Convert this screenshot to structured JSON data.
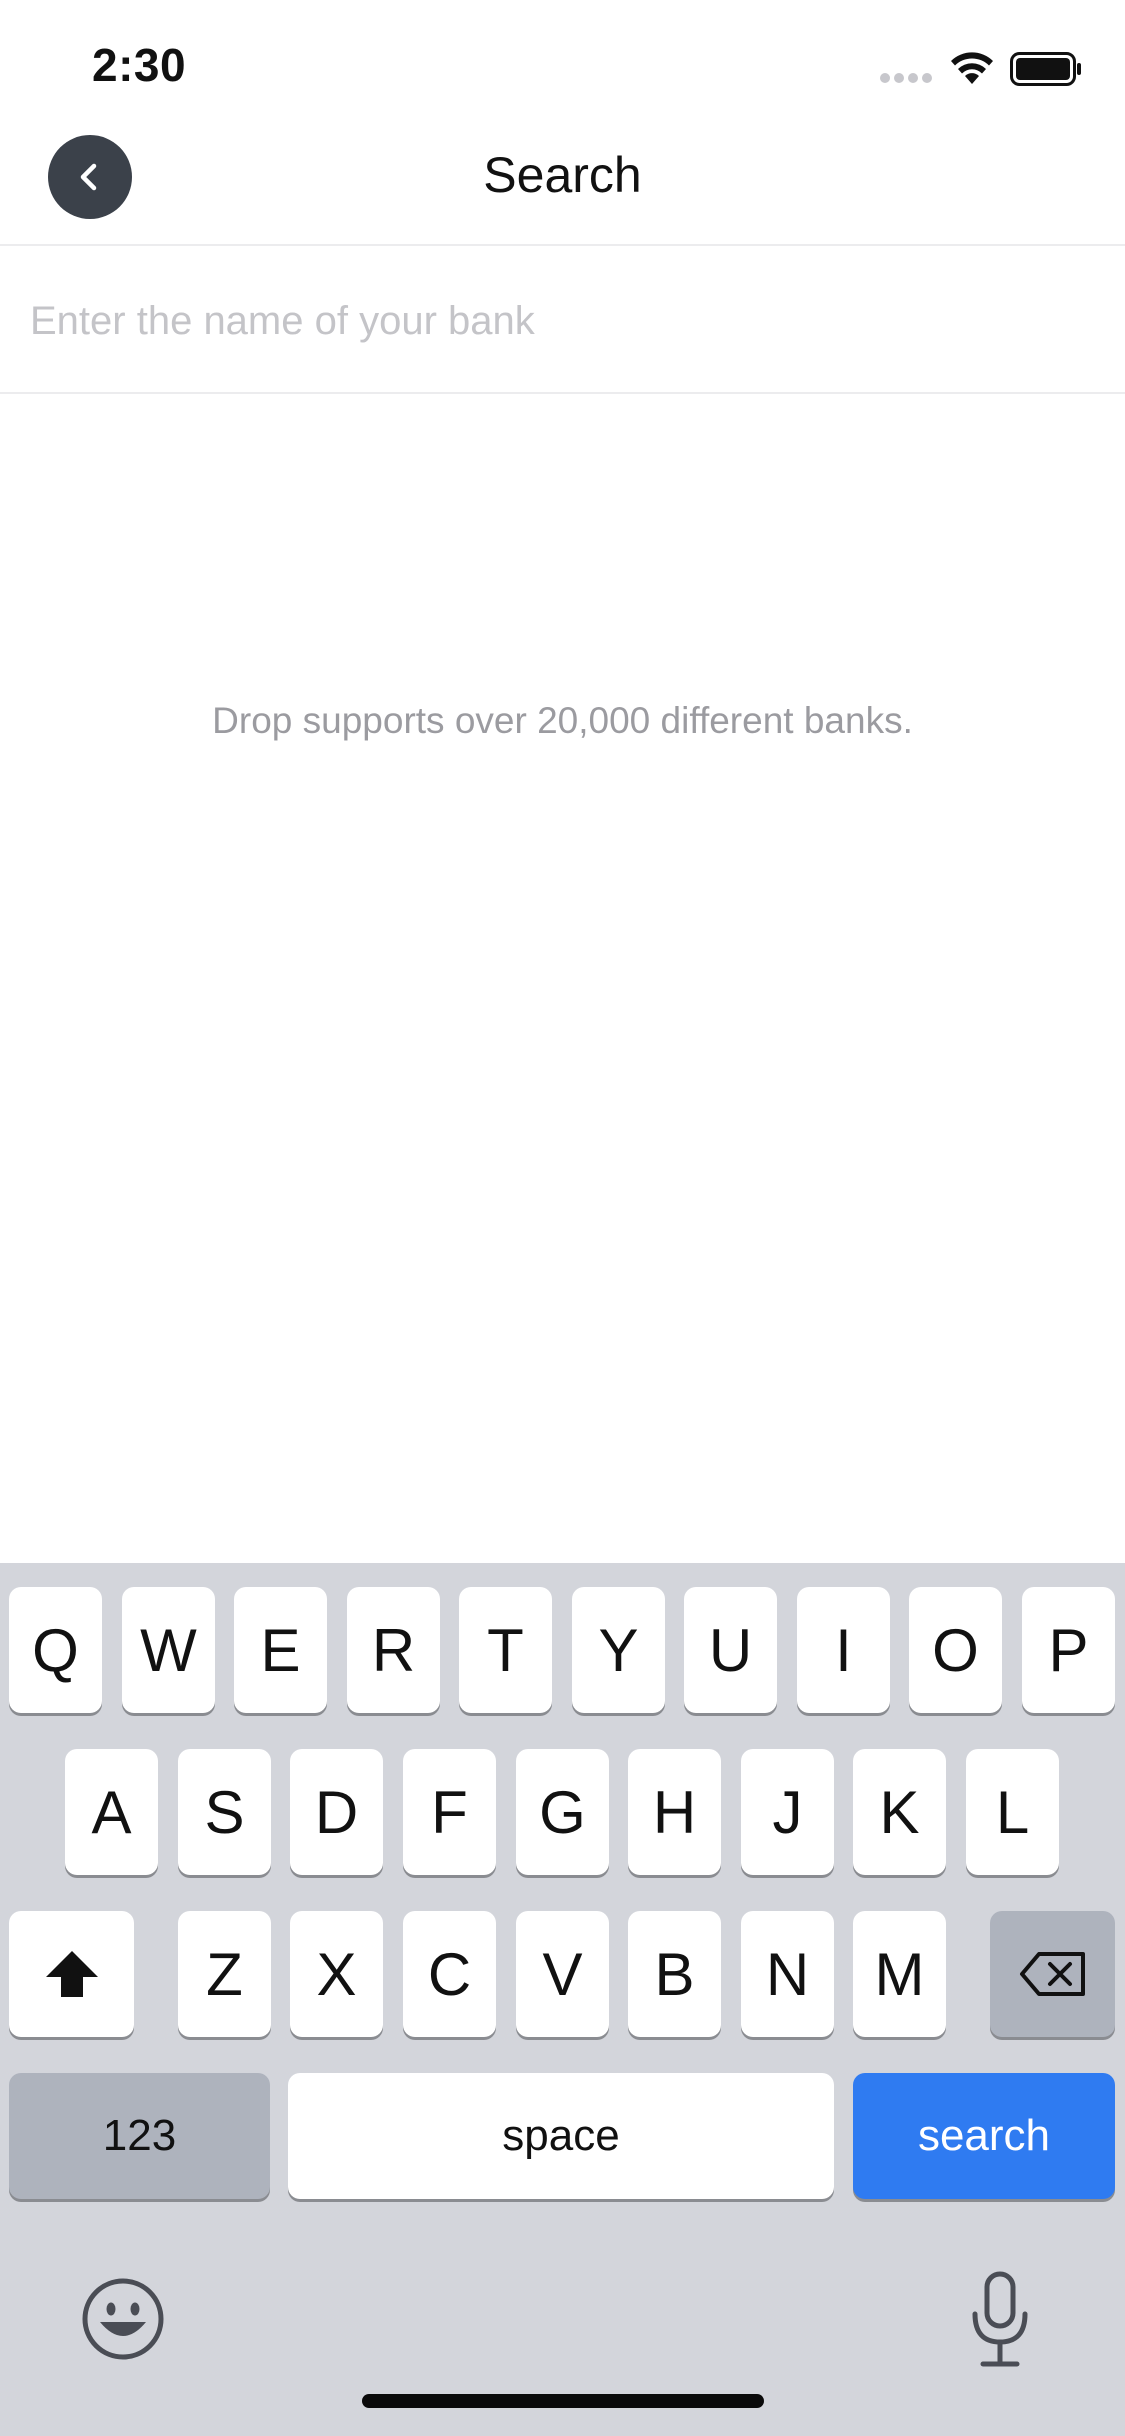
{
  "status_bar": {
    "time": "2:30"
  },
  "nav": {
    "title": "Search",
    "back_icon": "chevron-left-icon"
  },
  "search": {
    "value": "",
    "placeholder": "Enter the name of your bank"
  },
  "info": {
    "text": "Drop supports over 20,000 different banks."
  },
  "keyboard": {
    "row1": [
      "Q",
      "W",
      "E",
      "R",
      "T",
      "Y",
      "U",
      "I",
      "O",
      "P"
    ],
    "row2": [
      "A",
      "S",
      "D",
      "F",
      "G",
      "H",
      "J",
      "K",
      "L"
    ],
    "row3": [
      "Z",
      "X",
      "C",
      "V",
      "B",
      "N",
      "M"
    ],
    "numbers_label": "123",
    "space_label": "space",
    "search_label": "search",
    "shift_icon": "shift-icon",
    "delete_icon": "backspace-icon",
    "emoji_icon": "emoji-icon",
    "mic_icon": "microphone-icon"
  },
  "colors": {
    "accent": "#2f7bf1",
    "keyboard_bg": "#d3d5db",
    "back_button": "#3b414a"
  }
}
